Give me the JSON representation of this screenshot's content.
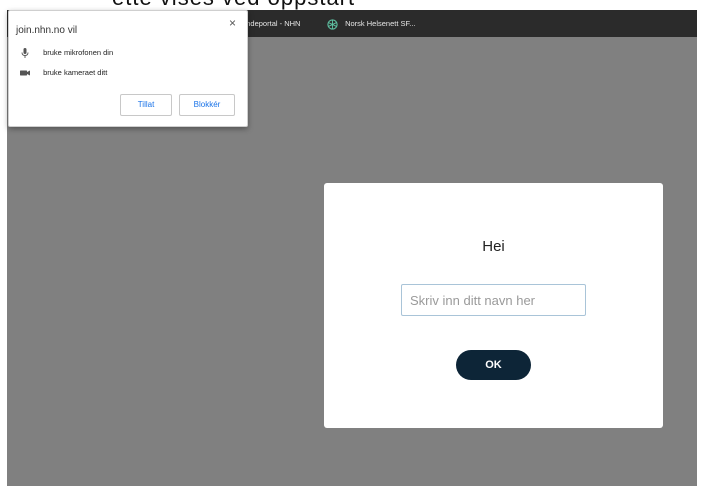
{
  "caption": {
    "text": "ette vises ved oppstart"
  },
  "bookmarks": [
    {
      "label": "...ndeportal - NHN"
    },
    {
      "label": "Norsk Helsenett SF..."
    }
  ],
  "permission_popup": {
    "title": "join.nhn.no vil",
    "close_glyph": "×",
    "permissions": [
      {
        "icon": "microphone-icon",
        "label": "bruke mikrofonen din"
      },
      {
        "icon": "camera-icon",
        "label": "bruke kameraet ditt"
      }
    ],
    "allow_label": "Tillat",
    "block_label": "Blokkér"
  },
  "dialog": {
    "title": "Hei",
    "input_placeholder": "Skriv inn ditt navn her",
    "input_value": "",
    "ok_label": "OK"
  },
  "colors": {
    "page_background": "#808080",
    "bookmarks_bar": "#2b2b2b",
    "ok_button": "#0d2537",
    "link_blue": "#1a73e8"
  }
}
